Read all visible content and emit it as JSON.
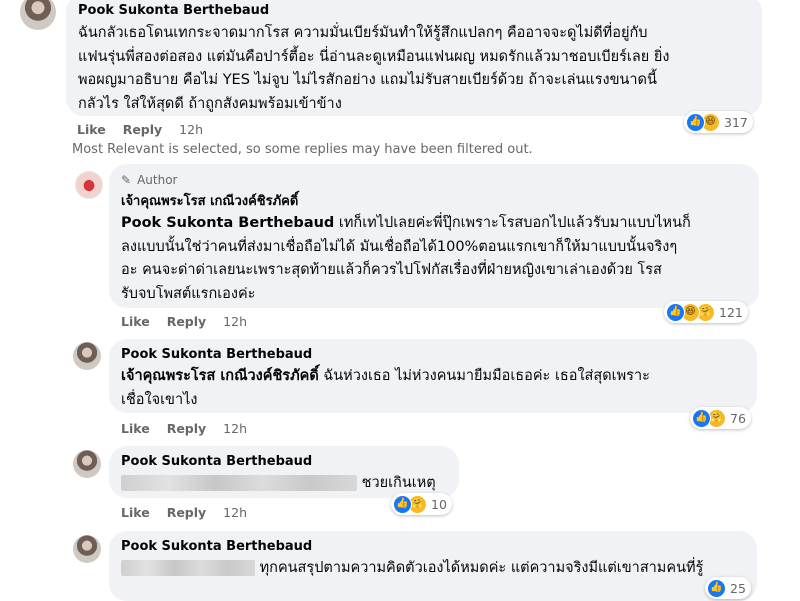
{
  "comments": [
    {
      "name": "Pook Sukonta Berthebaud",
      "lines": [
        "ฉันกลัวเธอโดนเทกระจาดมากโรส ความมั่นเบียร์มันทำให้รู้สึกแปลกๆ คืออาจจะดูไม่ดีที่อยู่กับ",
        "แฟนรุ่นพี่สองต่อสอง แต่มันคือปาร์ตี้อะ นี่อ่านละดูเหมือนแฟนผญ หมดรักแล้วมาชอบเบียร์เลย ยิ่ง",
        "พอผญมาอธิบาย คือไม่ YES ไม่จูบ ไม่ไรสักอย่าง แถมไม่รับสายเบียร์ด้วย ถ้าจะเล่นแรงขนาดนี้",
        "กลัวไร ใส่ให้สุดดี ถ้าถูกสังคมพร้อมเข้าข้าง"
      ],
      "like": "Like",
      "reply": "Reply",
      "time": "12h",
      "reactions": [
        "like",
        "haha"
      ],
      "count": "317"
    }
  ],
  "filter_note": "Most Relevant is selected, so some replies may have been filtered out.",
  "replies": [
    {
      "badge": "Author",
      "name": "เจ้าคุณพระโรส เกณีวงค์ชิรภัคดิ์",
      "mention": "Pook Sukonta Berthebaud",
      "lines": [
        " เทก็เทไปเลยค่ะพี่ปุ๊กเพราะโรสบอกไปแล้วรับมาแบบไหนก็",
        "ลงแบบนั้นใช่ว่าคนที่ส่งมาเชื่อถือไม่ได้ มันเชื่อถือได้100%ตอนแรกเขาก็ให้มาแบบนั้นจริงๆ",
        "อะ คนจะด่าด่าเลยนะเพราะสุดท้ายแล้วก็ควรไปโฟกัสเรื่องที่ฝ่ายหญิงเขาเล่าเองด้วย โรส",
        "รับจบโพสต์แรกเองค่ะ"
      ],
      "like": "Like",
      "reply": "Reply",
      "time": "12h",
      "reactions": [
        "like",
        "haha",
        "care"
      ],
      "count": "121"
    },
    {
      "name": "Pook Sukonta Berthebaud",
      "mention": "เจ้าคุณพระโรส เกณีวงค์ชิรภัคดิ์",
      "lines": [
        " ฉันห่วงเธอ ไม่ห่วงคนมายืมมือเธอค่ะ เธอใส่สุดเพราะ",
        "เชื่อใจเขาไง"
      ],
      "like": "Like",
      "reply": "Reply",
      "time": "12h",
      "reactions": [
        "like",
        "care"
      ],
      "count": "76"
    },
    {
      "name": "Pook Sukonta Berthebaud",
      "text_after_blur": " ชวยเกินเหตุ",
      "like": "Like",
      "reply": "Reply",
      "time": "12h",
      "reactions": [
        "like",
        "care"
      ],
      "count": "10"
    },
    {
      "name": "Pook Sukonta Berthebaud",
      "text_after_blur": " ทุกคนสรุปตามความคิดตัวเองได้หมดค่ะ แต่ความจริงมีแต่เขาสามคนที่รู้",
      "count": "25"
    }
  ],
  "icons": {
    "like": "thumbs-up-icon",
    "haha": "laughing-face-icon",
    "care": "care-face-icon",
    "author": "pencil-icon"
  },
  "colors": {
    "bubble": "#f0f2f5",
    "like_blue": "#1877f2",
    "meta_gray": "#65676b"
  }
}
